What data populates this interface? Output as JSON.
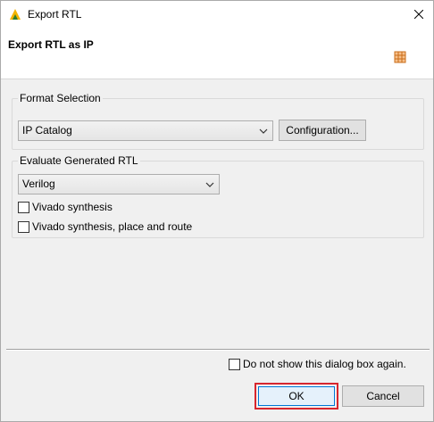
{
  "window": {
    "title": "Export RTL"
  },
  "header": {
    "title": "Export RTL as IP"
  },
  "format_selection": {
    "label": "Format Selection",
    "format_value": "IP Catalog",
    "configuration_label": "Configuration..."
  },
  "evaluate": {
    "label": "Evaluate Generated RTL",
    "language_value": "Verilog",
    "options": [
      {
        "label": "Vivado synthesis",
        "checked": false
      },
      {
        "label": "Vivado synthesis, place and route",
        "checked": false
      }
    ]
  },
  "footer": {
    "dont_show_label": "Do not show this dialog box again.",
    "ok_label": "OK",
    "cancel_label": "Cancel"
  },
  "colors": {
    "highlight": "#d7262e",
    "accent": "#0078d7"
  }
}
